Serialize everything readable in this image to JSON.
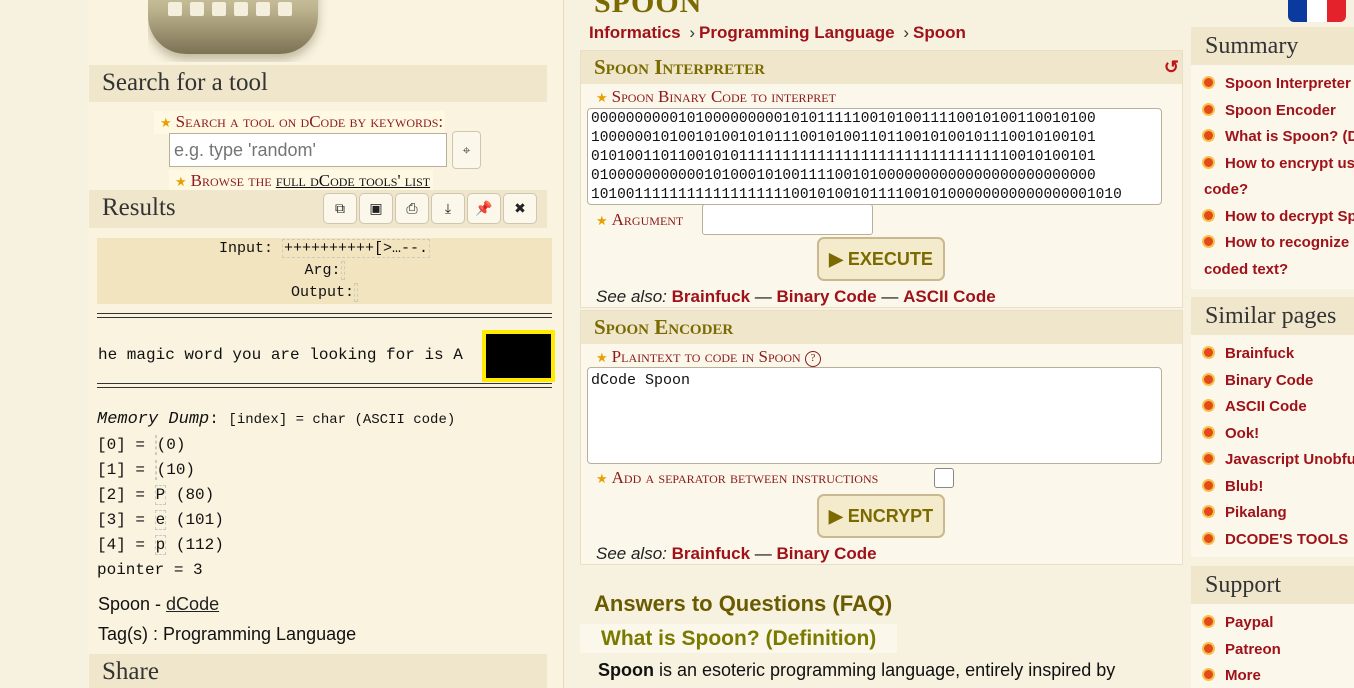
{
  "page": {
    "heading": "SPOON",
    "breadcrumb": [
      "Informatics",
      "Programming Language",
      "Spoon"
    ]
  },
  "left": {
    "search_title": "Search for a tool",
    "search_kw_label": "Search a tool on dCode by keywords:",
    "search_placeholder": "e.g. type 'random'",
    "search_go_icon": "magic-wand-icon",
    "browse_prefix": "Browse the ",
    "browse_link": "full dCode tools' list",
    "results_title": "Results",
    "result_tools": [
      "copy-icon",
      "save-icon",
      "print-icon",
      "download-icon",
      "pin-icon",
      "close-icon"
    ],
    "io": {
      "input_label": "Input:",
      "input_value": "++++++++++[>…--.",
      "arg_label": "Arg:",
      "arg_value": "",
      "output_label": "Output:",
      "output_value": ""
    },
    "output_line": "he magic word you are looking for is A",
    "memdump": {
      "title": "Memory Dump",
      "subtitle": "[index] = char (ASCII code)",
      "rows": [
        {
          "index": "[0] =",
          "char": " ",
          "code": "(0)"
        },
        {
          "index": "[1] =",
          "char": " ",
          "code": "(10)"
        },
        {
          "index": "[2] =",
          "char": "P",
          "code": "(80)"
        },
        {
          "index": "[3] =",
          "char": "e",
          "code": "(101)"
        },
        {
          "index": "[4] =",
          "char": "p",
          "code": "(112)"
        }
      ],
      "pointer": "pointer = 3"
    },
    "credit_prefix": "Spoon - ",
    "credit_link": "dCode",
    "tags": "Tag(s) : Programming Language",
    "share_title": "Share"
  },
  "interpreter": {
    "title": "Spoon Interpreter",
    "reset_icon": "↺",
    "code_label": "Spoon Binary Code to interpret",
    "code_value": "0000000000101000000000101011111001010011110010100110010100\n1000000101001010010101110010100110110010100101110010100101\n0101001101100101011111111111111111111111111111110010100101\n0100000000000101000101001111001010000000000000000000000000\n1010011111111111111111100101001011110010100000000000000001010",
    "argument_label": "Argument",
    "argument_value": "",
    "execute_button": "▶ EXECUTE",
    "see_also_label": "See also:",
    "see_also": [
      "Brainfuck",
      "Binary Code",
      "ASCII Code"
    ]
  },
  "encoder": {
    "title": "Spoon Encoder",
    "plain_label": "Plaintext to code in Spoon",
    "help_icon": "?",
    "plain_value": "dCode Spoon",
    "separator_label": "Add a separator between instructions",
    "encrypt_button": "▶ ENCRYPT",
    "see_also_label": "See also:",
    "see_also": [
      "Brainfuck",
      "Binary Code"
    ]
  },
  "faq": {
    "title": "Answers to Questions (FAQ)",
    "question": "What is Spoon? (Definition)",
    "answer_bold": "Spoon",
    "answer_rest": " is an esoteric programming language, entirely inspired by"
  },
  "sidebar": {
    "summary_title": "Summary",
    "summary_items": [
      "Spoon Interpreter",
      "Spoon Encoder",
      "What is Spoon? (D",
      "How to encrypt us",
      "code?",
      "How to decrypt Sp",
      "How to recognize",
      "coded text?"
    ],
    "similar_title": "Similar pages",
    "similar_items": [
      "Brainfuck",
      "Binary Code",
      "ASCII Code",
      "Ook!",
      "Javascript Unobfu",
      "Blub!",
      "Pikalang",
      "DCODE'S TOOLS"
    ],
    "support_title": "Support",
    "support_items": [
      "Paypal",
      "Patreon",
      "More"
    ]
  },
  "colors": {
    "link": "#a0121a",
    "heading_olive": "#7a6a00",
    "flag_blue": "#0b3a9e",
    "flag_white": "#ffffff",
    "flag_red": "#e3222b",
    "redact_border": "#ffea00"
  }
}
